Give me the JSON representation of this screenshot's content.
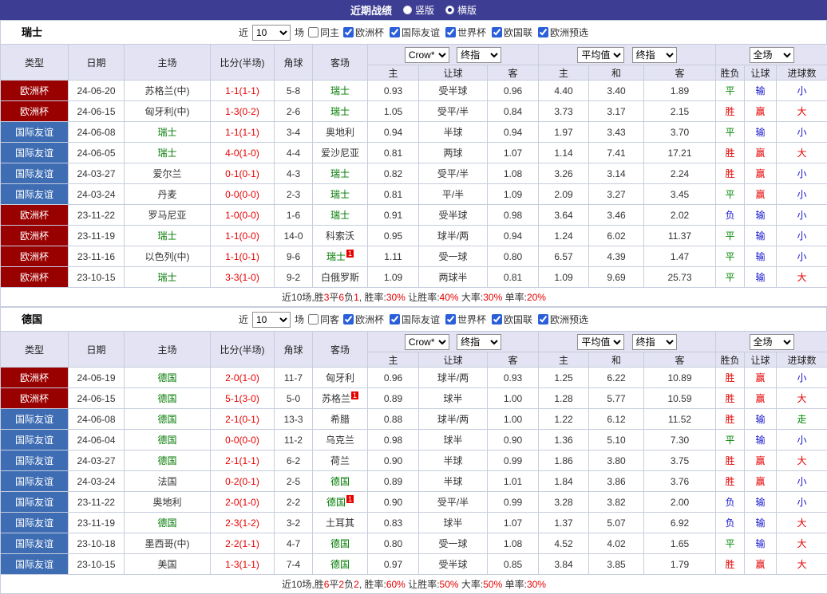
{
  "topbar": {
    "title": "近期战绩",
    "radios": [
      {
        "label": "竖版",
        "selected": false
      },
      {
        "label": "横版",
        "selected": true
      }
    ]
  },
  "columns": {
    "type": "类型",
    "date": "日期",
    "home": "主场",
    "score": "比分(半场)",
    "corner": "角球",
    "away": "客场",
    "sub": [
      "主",
      "让球",
      "客",
      "主",
      "和",
      "客",
      "胜负",
      "让球",
      "进球数"
    ]
  },
  "league_colors": {
    "欧洲杯": "#990000",
    "国际友谊": "#3e6db4"
  },
  "result_colors": {
    "r": "#e60000",
    "g": "#008800",
    "b": "#1414cc"
  },
  "sections": [
    {
      "team": "瑞士",
      "near_label": "近",
      "count": "10",
      "field_label": "场",
      "same_filter": {
        "label": "同主",
        "checked": false
      },
      "league_filters": [
        {
          "label": "欧洲杯",
          "checked": true
        },
        {
          "label": "国际友谊",
          "checked": true
        },
        {
          "label": "世界杯",
          "checked": true
        },
        {
          "label": "欧国联",
          "checked": true
        },
        {
          "label": "欧洲预选",
          "checked": true
        }
      ],
      "selects": {
        "book": "Crow*",
        "book_stage": "终指",
        "avg": "平均值",
        "avg_stage": "终指",
        "scope": "全场"
      },
      "rows": [
        {
          "league": "欧洲杯",
          "date": "24-06-20",
          "home": "苏格兰(中)",
          "home_t": false,
          "home_rc": false,
          "score": "1-1(1-1)",
          "corner": "5-8",
          "away": "瑞士",
          "away_t": true,
          "away_rc": false,
          "odds": [
            "0.93",
            "受半球",
            "0.96"
          ],
          "avg": [
            "4.40",
            "3.40",
            "1.89"
          ],
          "res": [
            [
              "平",
              "g"
            ],
            [
              "输",
              "b"
            ],
            [
              "小",
              "b"
            ]
          ]
        },
        {
          "league": "欧洲杯",
          "date": "24-06-15",
          "home": "匈牙利(中)",
          "home_t": false,
          "home_rc": false,
          "score": "1-3(0-2)",
          "corner": "2-6",
          "away": "瑞士",
          "away_t": true,
          "away_rc": false,
          "odds": [
            "1.05",
            "受平/半",
            "0.84"
          ],
          "avg": [
            "3.73",
            "3.17",
            "2.15"
          ],
          "res": [
            [
              "胜",
              "r"
            ],
            [
              "赢",
              "r"
            ],
            [
              "大",
              "r"
            ]
          ]
        },
        {
          "league": "国际友谊",
          "date": "24-06-08",
          "home": "瑞士",
          "home_t": true,
          "home_rc": false,
          "score": "1-1(1-1)",
          "corner": "3-4",
          "away": "奥地利",
          "away_t": false,
          "away_rc": false,
          "odds": [
            "0.94",
            "半球",
            "0.94"
          ],
          "avg": [
            "1.97",
            "3.43",
            "3.70"
          ],
          "res": [
            [
              "平",
              "g"
            ],
            [
              "输",
              "b"
            ],
            [
              "小",
              "b"
            ]
          ]
        },
        {
          "league": "国际友谊",
          "date": "24-06-05",
          "home": "瑞士",
          "home_t": true,
          "home_rc": false,
          "score": "4-0(1-0)",
          "corner": "4-4",
          "away": "爱沙尼亚",
          "away_t": false,
          "away_rc": false,
          "odds": [
            "0.81",
            "两球",
            "1.07"
          ],
          "avg": [
            "1.14",
            "7.41",
            "17.21"
          ],
          "res": [
            [
              "胜",
              "r"
            ],
            [
              "赢",
              "r"
            ],
            [
              "大",
              "r"
            ]
          ]
        },
        {
          "league": "国际友谊",
          "date": "24-03-27",
          "home": "爱尔兰",
          "home_t": false,
          "home_rc": false,
          "score": "0-1(0-1)",
          "corner": "4-3",
          "away": "瑞士",
          "away_t": true,
          "away_rc": false,
          "odds": [
            "0.82",
            "受平/半",
            "1.08"
          ],
          "avg": [
            "3.26",
            "3.14",
            "2.24"
          ],
          "res": [
            [
              "胜",
              "r"
            ],
            [
              "赢",
              "r"
            ],
            [
              "小",
              "b"
            ]
          ]
        },
        {
          "league": "国际友谊",
          "date": "24-03-24",
          "home": "丹麦",
          "home_t": false,
          "home_rc": false,
          "score": "0-0(0-0)",
          "corner": "2-3",
          "away": "瑞士",
          "away_t": true,
          "away_rc": false,
          "odds": [
            "0.81",
            "平/半",
            "1.09"
          ],
          "avg": [
            "2.09",
            "3.27",
            "3.45"
          ],
          "res": [
            [
              "平",
              "g"
            ],
            [
              "赢",
              "r"
            ],
            [
              "小",
              "b"
            ]
          ]
        },
        {
          "league": "欧洲杯",
          "date": "23-11-22",
          "home": "罗马尼亚",
          "home_t": false,
          "home_rc": false,
          "score": "1-0(0-0)",
          "corner": "1-6",
          "away": "瑞士",
          "away_t": true,
          "away_rc": false,
          "odds": [
            "0.91",
            "受半球",
            "0.98"
          ],
          "avg": [
            "3.64",
            "3.46",
            "2.02"
          ],
          "res": [
            [
              "负",
              "b"
            ],
            [
              "输",
              "b"
            ],
            [
              "小",
              "b"
            ]
          ]
        },
        {
          "league": "欧洲杯",
          "date": "23-11-19",
          "home": "瑞士",
          "home_t": true,
          "home_rc": false,
          "score": "1-1(0-0)",
          "corner": "14-0",
          "away": "科索沃",
          "away_t": false,
          "away_rc": false,
          "odds": [
            "0.95",
            "球半/两",
            "0.94"
          ],
          "avg": [
            "1.24",
            "6.02",
            "11.37"
          ],
          "res": [
            [
              "平",
              "g"
            ],
            [
              "输",
              "b"
            ],
            [
              "小",
              "b"
            ]
          ]
        },
        {
          "league": "欧洲杯",
          "date": "23-11-16",
          "home": "以色列(中)",
          "home_t": false,
          "home_rc": false,
          "score": "1-1(0-1)",
          "corner": "9-6",
          "away": "瑞士",
          "away_t": true,
          "away_rc": true,
          "odds": [
            "1.11",
            "受一球",
            "0.80"
          ],
          "avg": [
            "6.57",
            "4.39",
            "1.47"
          ],
          "res": [
            [
              "平",
              "g"
            ],
            [
              "输",
              "b"
            ],
            [
              "小",
              "b"
            ]
          ]
        },
        {
          "league": "欧洲杯",
          "date": "23-10-15",
          "home": "瑞士",
          "home_t": true,
          "home_rc": false,
          "score": "3-3(1-0)",
          "corner": "9-2",
          "away": "白俄罗斯",
          "away_t": false,
          "away_rc": false,
          "odds": [
            "1.09",
            "两球半",
            "0.81"
          ],
          "avg": [
            "1.09",
            "9.69",
            "25.73"
          ],
          "res": [
            [
              "平",
              "g"
            ],
            [
              "输",
              "b"
            ],
            [
              "大",
              "r"
            ]
          ]
        }
      ],
      "summary": [
        [
          "近10场,胜",
          "k"
        ],
        [
          "3",
          "r"
        ],
        [
          "平",
          "k"
        ],
        [
          "6",
          "r"
        ],
        [
          "负",
          "k"
        ],
        [
          "1",
          "r"
        ],
        [
          ", 胜率:",
          "k"
        ],
        [
          "30%",
          "r"
        ],
        [
          " 让胜率:",
          "k"
        ],
        [
          "40%",
          "r"
        ],
        [
          " 大率:",
          "k"
        ],
        [
          "30%",
          "r"
        ],
        [
          " 单率:",
          "k"
        ],
        [
          "20%",
          "r"
        ]
      ]
    },
    {
      "team": "德国",
      "near_label": "近",
      "count": "10",
      "field_label": "场",
      "same_filter": {
        "label": "同客",
        "checked": false
      },
      "league_filters": [
        {
          "label": "欧洲杯",
          "checked": true
        },
        {
          "label": "国际友谊",
          "checked": true
        },
        {
          "label": "世界杯",
          "checked": true
        },
        {
          "label": "欧国联",
          "checked": true
        },
        {
          "label": "欧洲预选",
          "checked": true
        }
      ],
      "selects": {
        "book": "Crow*",
        "book_stage": "终指",
        "avg": "平均值",
        "avg_stage": "终指",
        "scope": "全场"
      },
      "rows": [
        {
          "league": "欧洲杯",
          "date": "24-06-19",
          "home": "德国",
          "home_t": true,
          "home_rc": false,
          "score": "2-0(1-0)",
          "corner": "11-7",
          "away": "匈牙利",
          "away_t": false,
          "away_rc": false,
          "odds": [
            "0.96",
            "球半/两",
            "0.93"
          ],
          "avg": [
            "1.25",
            "6.22",
            "10.89"
          ],
          "res": [
            [
              "胜",
              "r"
            ],
            [
              "赢",
              "r"
            ],
            [
              "小",
              "b"
            ]
          ]
        },
        {
          "league": "欧洲杯",
          "date": "24-06-15",
          "home": "德国",
          "home_t": true,
          "home_rc": false,
          "score": "5-1(3-0)",
          "corner": "5-0",
          "away": "苏格兰",
          "away_t": false,
          "away_rc": true,
          "odds": [
            "0.89",
            "球半",
            "1.00"
          ],
          "avg": [
            "1.28",
            "5.77",
            "10.59"
          ],
          "res": [
            [
              "胜",
              "r"
            ],
            [
              "赢",
              "r"
            ],
            [
              "大",
              "r"
            ]
          ]
        },
        {
          "league": "国际友谊",
          "date": "24-06-08",
          "home": "德国",
          "home_t": true,
          "home_rc": false,
          "score": "2-1(0-1)",
          "corner": "13-3",
          "away": "希腊",
          "away_t": false,
          "away_rc": false,
          "odds": [
            "0.88",
            "球半/两",
            "1.00"
          ],
          "avg": [
            "1.22",
            "6.12",
            "11.52"
          ],
          "res": [
            [
              "胜",
              "r"
            ],
            [
              "输",
              "b"
            ],
            [
              "走",
              "g"
            ]
          ]
        },
        {
          "league": "国际友谊",
          "date": "24-06-04",
          "home": "德国",
          "home_t": true,
          "home_rc": false,
          "score": "0-0(0-0)",
          "corner": "11-2",
          "away": "乌克兰",
          "away_t": false,
          "away_rc": false,
          "odds": [
            "0.98",
            "球半",
            "0.90"
          ],
          "avg": [
            "1.36",
            "5.10",
            "7.30"
          ],
          "res": [
            [
              "平",
              "g"
            ],
            [
              "输",
              "b"
            ],
            [
              "小",
              "b"
            ]
          ]
        },
        {
          "league": "国际友谊",
          "date": "24-03-27",
          "home": "德国",
          "home_t": true,
          "home_rc": false,
          "score": "2-1(1-1)",
          "corner": "6-2",
          "away": "荷兰",
          "away_t": false,
          "away_rc": false,
          "odds": [
            "0.90",
            "半球",
            "0.99"
          ],
          "avg": [
            "1.86",
            "3.80",
            "3.75"
          ],
          "res": [
            [
              "胜",
              "r"
            ],
            [
              "赢",
              "r"
            ],
            [
              "大",
              "r"
            ]
          ]
        },
        {
          "league": "国际友谊",
          "date": "24-03-24",
          "home": "法国",
          "home_t": false,
          "home_rc": false,
          "score": "0-2(0-1)",
          "corner": "2-5",
          "away": "德国",
          "away_t": true,
          "away_rc": false,
          "odds": [
            "0.89",
            "半球",
            "1.01"
          ],
          "avg": [
            "1.84",
            "3.86",
            "3.76"
          ],
          "res": [
            [
              "胜",
              "r"
            ],
            [
              "赢",
              "r"
            ],
            [
              "小",
              "b"
            ]
          ]
        },
        {
          "league": "国际友谊",
          "date": "23-11-22",
          "home": "奥地利",
          "home_t": false,
          "home_rc": false,
          "score": "2-0(1-0)",
          "corner": "2-2",
          "away": "德国",
          "away_t": true,
          "away_rc": true,
          "odds": [
            "0.90",
            "受平/半",
            "0.99"
          ],
          "avg": [
            "3.28",
            "3.82",
            "2.00"
          ],
          "res": [
            [
              "负",
              "b"
            ],
            [
              "输",
              "b"
            ],
            [
              "小",
              "b"
            ]
          ]
        },
        {
          "league": "国际友谊",
          "date": "23-11-19",
          "home": "德国",
          "home_t": true,
          "home_rc": false,
          "score": "2-3(1-2)",
          "corner": "3-2",
          "away": "土耳其",
          "away_t": false,
          "away_rc": false,
          "odds": [
            "0.83",
            "球半",
            "1.07"
          ],
          "avg": [
            "1.37",
            "5.07",
            "6.92"
          ],
          "res": [
            [
              "负",
              "b"
            ],
            [
              "输",
              "b"
            ],
            [
              "大",
              "r"
            ]
          ]
        },
        {
          "league": "国际友谊",
          "date": "23-10-18",
          "home": "墨西哥(中)",
          "home_t": false,
          "home_rc": false,
          "score": "2-2(1-1)",
          "corner": "4-7",
          "away": "德国",
          "away_t": true,
          "away_rc": false,
          "odds": [
            "0.80",
            "受一球",
            "1.08"
          ],
          "avg": [
            "4.52",
            "4.02",
            "1.65"
          ],
          "res": [
            [
              "平",
              "g"
            ],
            [
              "输",
              "b"
            ],
            [
              "大",
              "r"
            ]
          ]
        },
        {
          "league": "国际友谊",
          "date": "23-10-15",
          "home": "美国",
          "home_t": false,
          "home_rc": false,
          "score": "1-3(1-1)",
          "corner": "7-4",
          "away": "德国",
          "away_t": true,
          "away_rc": false,
          "odds": [
            "0.97",
            "受半球",
            "0.85"
          ],
          "avg": [
            "3.84",
            "3.85",
            "1.79"
          ],
          "res": [
            [
              "胜",
              "r"
            ],
            [
              "赢",
              "r"
            ],
            [
              "大",
              "r"
            ]
          ]
        }
      ],
      "summary": [
        [
          "近10场,胜",
          "k"
        ],
        [
          "6",
          "r"
        ],
        [
          "平",
          "k"
        ],
        [
          "2",
          "r"
        ],
        [
          "负",
          "k"
        ],
        [
          "2",
          "r"
        ],
        [
          ", 胜率:",
          "k"
        ],
        [
          "60%",
          "r"
        ],
        [
          " 让胜率:",
          "k"
        ],
        [
          "50%",
          "r"
        ],
        [
          " 大率:",
          "k"
        ],
        [
          "50%",
          "r"
        ],
        [
          " 单率:",
          "k"
        ],
        [
          "30%",
          "r"
        ]
      ]
    }
  ]
}
